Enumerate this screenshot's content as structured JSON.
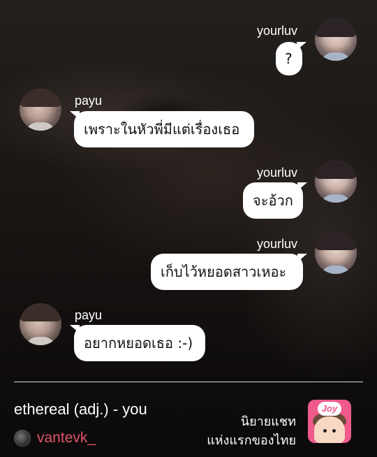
{
  "chat": {
    "messages": [
      {
        "sender": "yourluv",
        "side": "right",
        "text": "?"
      },
      {
        "sender": "payu",
        "side": "left",
        "text": "เพราะในหัวพี่มีแต่เรื่องเธอ"
      },
      {
        "sender": "yourluv",
        "side": "right",
        "text": "จะอ้วก"
      },
      {
        "sender": "yourluv",
        "side": "right",
        "text": "เก็บไว้หยอดสาวเหอะ"
      },
      {
        "sender": "payu",
        "side": "left",
        "text": "อยากหยอดเธอ :-)"
      }
    ]
  },
  "footer": {
    "story_title": "ethereal (adj.) - you",
    "author_handle": "vantevk_",
    "promo_line_1": "นิยายแชท",
    "promo_line_2": "แห่งแรกของไทย",
    "app_logo_text": "Joy",
    "author_icon": "instagram-avatar-icon"
  },
  "colors": {
    "bubble": "#ffffff",
    "handle": "#e0556d",
    "logo_bg": "#ef5a8a"
  }
}
